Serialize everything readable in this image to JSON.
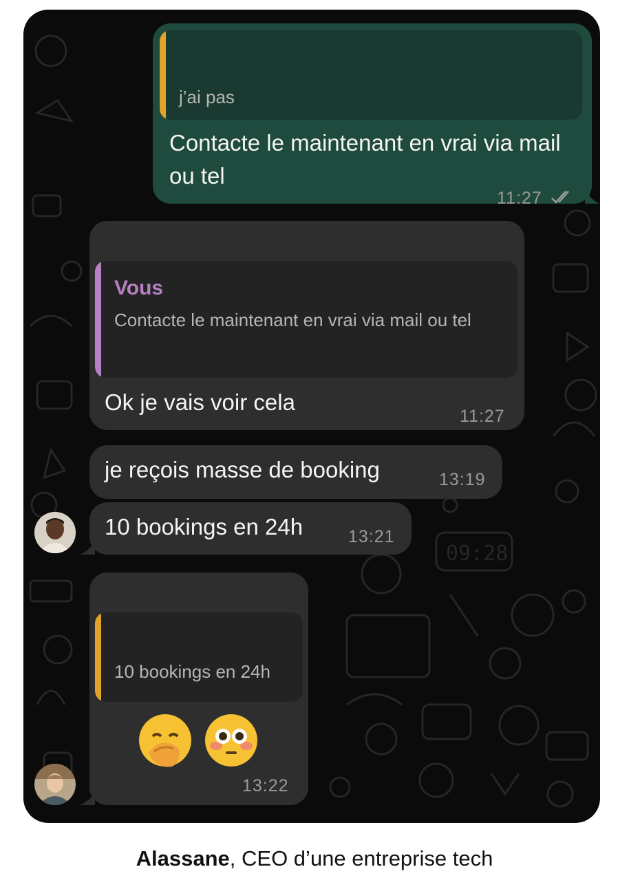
{
  "chat": {
    "messages": [
      {
        "direction": "outgoing",
        "reply_quote": {
          "sender": "",
          "text": "j’ai pas",
          "bar_color": "#e2a32a"
        },
        "text": "Contacte le maintenant en vrai via mail ou tel",
        "time": "11:27",
        "status": "read"
      },
      {
        "direction": "incoming",
        "reply_quote": {
          "sender": "Vous",
          "text": "Contacte le maintenant en vrai via mail ou tel",
          "bar_color": "#b781c4",
          "sender_color": "#b781c4"
        },
        "text": "Ok je vais voir cela",
        "time": "11:27"
      },
      {
        "direction": "incoming",
        "text": "je reçois masse de booking",
        "time": "13:19"
      },
      {
        "direction": "incoming",
        "text": "10 bookings en 24h",
        "time": "13:21",
        "avatar": "avatar-1"
      },
      {
        "direction": "incoming",
        "reply_quote": {
          "sender": "",
          "text": "10 bookings en 24h",
          "bar_color": "#e2a32a"
        },
        "emojis": [
          "face-with-hand-over-mouth",
          "flushed-face"
        ],
        "time": "13:22",
        "avatar": "avatar-2"
      }
    ]
  },
  "caption": {
    "name": "Alassane",
    "rest": ", CEO d’une entreprise tech"
  },
  "colors": {
    "outgoing": "#1f4a3e",
    "incoming": "#2e2e2e",
    "background": "#0b0b0b"
  }
}
